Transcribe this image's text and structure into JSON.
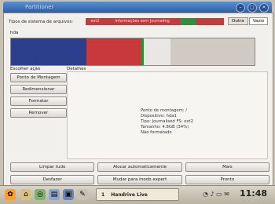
{
  "window": {
    "title": "Partitioner"
  },
  "header": {
    "fs_label": "Tipos de sistema de arquivos:",
    "legend": [
      {
        "label": "ext2",
        "color": "#c8393c"
      },
      {
        "label": "Informações sem journaling",
        "color": "#c8393c"
      },
      {
        "label": "",
        "color": "#2f8f3a"
      },
      {
        "label": "",
        "color": "#c8393c"
      },
      {
        "label": "",
        "color": "#c8393c"
      }
    ],
    "tabs": [
      "Outra",
      "Vazio"
    ]
  },
  "disk": {
    "label": "hda",
    "colors": {
      "used": "#2b3f8c",
      "partition": "#c8393c",
      "boundary": "#2f8f3a",
      "free": "#e9e7e3",
      "empty": "#cfcbc3"
    }
  },
  "actions": {
    "header": "Escolher ação",
    "items": [
      "Ponto de Montagem",
      "Redimensionar",
      "Formatar",
      "Remover"
    ]
  },
  "details": {
    "header": "Detalhes",
    "lines": [
      "Ponto de montagem: /",
      "Dispositivo: hda1",
      "Tipo: Journalised FS: ext2",
      "Tamanho: 4.8GB (34%)",
      "Não formatado"
    ]
  },
  "buttons": {
    "row1": [
      "Limpar tudo",
      "Alocar automaticamente",
      "Mais"
    ],
    "row2": [
      "Desfazer",
      "Mudar para modo expert",
      "Pronto"
    ]
  },
  "taskbar": {
    "task_number": "1",
    "task_label": "Handrive Live",
    "clock": "11:48"
  }
}
